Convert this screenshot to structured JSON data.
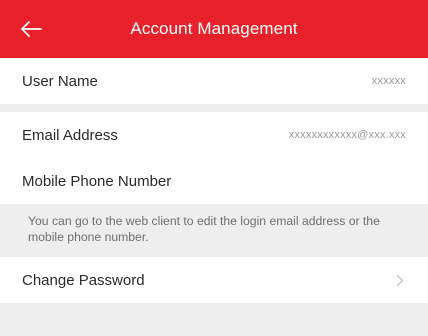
{
  "header": {
    "title": "Account Management"
  },
  "rows": {
    "username": {
      "label": "User Name",
      "value": "xxxxxx"
    },
    "email": {
      "label": "Email Address",
      "value": "xxxxxxxxxxxx@xxx.xxx"
    },
    "mobile": {
      "label": "Mobile Phone Number"
    },
    "password": {
      "label": "Change Password"
    }
  },
  "note": "You can go to the web client to edit the login email address or the mobile phone number.",
  "colors": {
    "header_bg": "#e8202a",
    "page_bg": "#eeeeee",
    "row_bg": "#ffffff"
  },
  "icons": {
    "back": "back-arrow-icon",
    "chevron": "chevron-right-icon"
  }
}
